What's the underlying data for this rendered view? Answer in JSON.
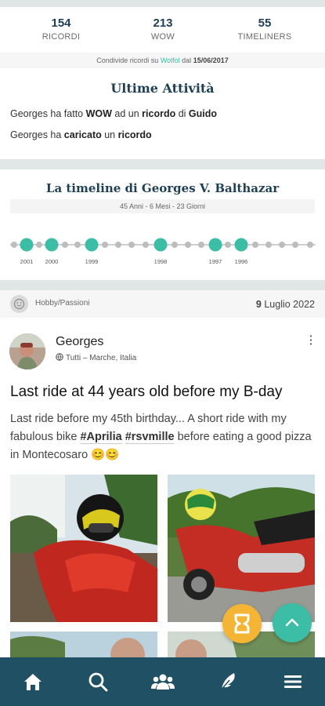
{
  "stats": [
    {
      "value": "154",
      "label": "RICORDI"
    },
    {
      "value": "213",
      "label": "WOW"
    },
    {
      "value": "55",
      "label": "TIMELINERS"
    }
  ],
  "since": {
    "prefix": "Condivide ricordi su",
    "app": "Wolfol",
    "middle": "dal",
    "date": "15/06/2017"
  },
  "activities": {
    "title": "Ultime Attività",
    "line1": {
      "a": "Georges ha fatto ",
      "b": "WOW",
      "c": " ad un ",
      "d": "ricordo",
      "e": " di ",
      "f": "Guido"
    },
    "line2": {
      "a": "Georges ha ",
      "b": "caricato",
      "c": " un ",
      "d": "ricordo"
    }
  },
  "timeline": {
    "title": "La timeline di Georges V. Balthazar",
    "age": "45 Anni - 6 Mesi - 23 Giorni",
    "years": [
      "2001",
      "2000",
      "1999",
      "1998",
      "1997",
      "1996"
    ]
  },
  "category": {
    "label": "Hobby/Passioni",
    "date_day": "9",
    "date_rest": " Luglio 2022"
  },
  "post": {
    "author": "Georges",
    "visibility": "Tutti – Marche, Italia",
    "title": "Last ride at 44 years old before my B-day",
    "text_a": "Last ride before my 45th birthday... A short ride with my fabulous bike ",
    "tag1": "#Aprilia",
    "tag2": "#rsvmille",
    "text_b": " before eating a good pizza in Montecosaro ",
    "emoji": "😊😊"
  },
  "icons": {
    "nav": [
      "home-icon",
      "search-icon",
      "people-icon",
      "feather-icon",
      "menu-icon"
    ]
  },
  "colors": {
    "brand": "#1f5064",
    "accent": "#3cbda5",
    "orange": "#f3b533"
  }
}
